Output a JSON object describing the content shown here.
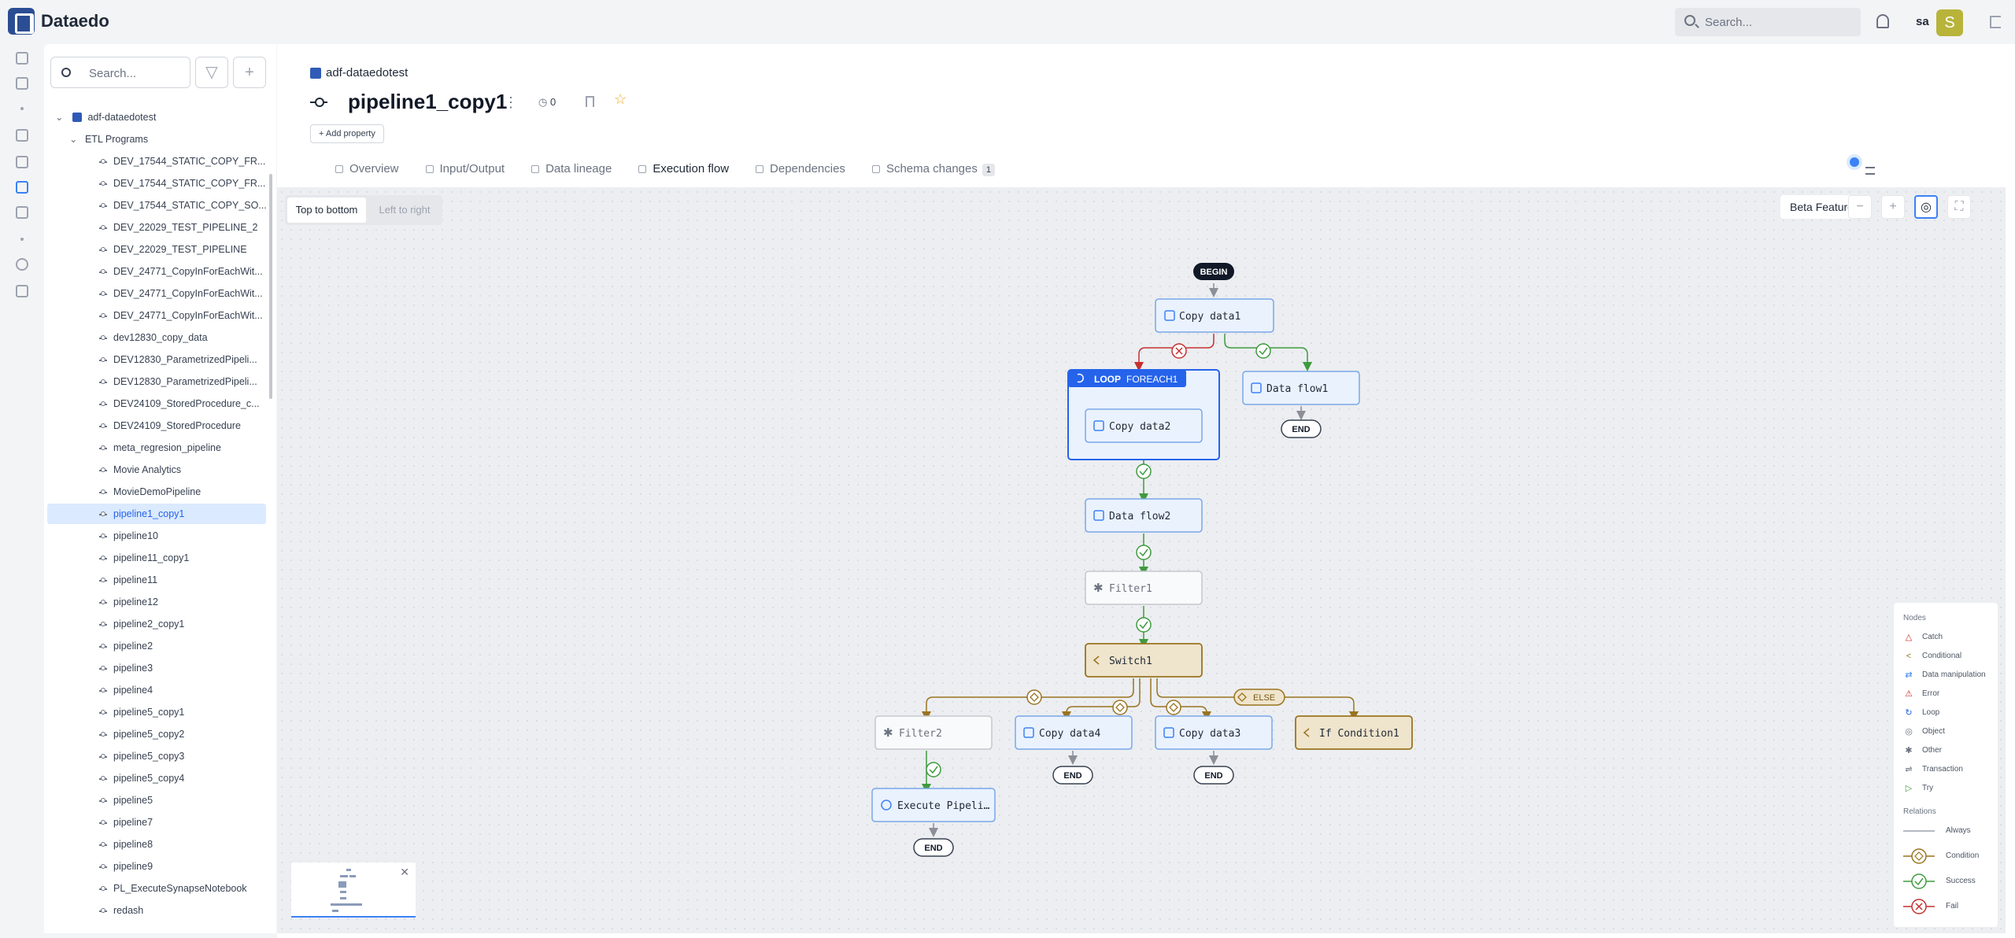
{
  "app": {
    "name": "Dataedo"
  },
  "topbar": {
    "search_placeholder": "Search...",
    "user_initials": "sa",
    "avatar_letter": "S"
  },
  "tree": {
    "search_placeholder": "Search...",
    "root": "adf-dataedotest",
    "folder": "ETL Programs",
    "items": [
      "DEV_17544_STATIC_COPY_FR...",
      "DEV_17544_STATIC_COPY_FR...",
      "DEV_17544_STATIC_COPY_SO...",
      "DEV_22029_TEST_PIPELINE_2",
      "DEV_22029_TEST_PIPELINE",
      "DEV_24771_CopyInForEachWit...",
      "DEV_24771_CopyInForEachWit...",
      "DEV_24771_CopyInForEachWit...",
      "dev12830_copy_data",
      "DEV12830_ParametrizedPipeli...",
      "DEV12830_ParametrizedPipeli...",
      "DEV24109_StoredProcedure_c...",
      "DEV24109_StoredProcedure",
      "meta_regresion_pipeline",
      "Movie Analytics",
      "MovieDemoPipeline",
      "pipeline1_copy1",
      "pipeline10",
      "pipeline11_copy1",
      "pipeline11",
      "pipeline12",
      "pipeline2_copy1",
      "pipeline2",
      "pipeline3",
      "pipeline4",
      "pipeline5_copy1",
      "pipeline5_copy2",
      "pipeline5_copy3",
      "pipeline5_copy4",
      "pipeline5",
      "pipeline7",
      "pipeline8",
      "pipeline9",
      "PL_ExecuteSynapseNotebook",
      "redash"
    ]
  },
  "header": {
    "breadcrumb": "adf-dataedotest",
    "title": "pipeline1_copy1",
    "notifications": "0",
    "add_property": "Add property"
  },
  "tabs": [
    {
      "label": "Overview"
    },
    {
      "label": "Input/Output"
    },
    {
      "label": "Data lineage"
    },
    {
      "label": "Execution flow"
    },
    {
      "label": "Dependencies"
    },
    {
      "label": "Schema changes",
      "badge": "1"
    }
  ],
  "canvas": {
    "layout_on": "Top to bottom",
    "layout_off": "Left to right",
    "beta": "Beta Feature"
  },
  "flow": {
    "begin": "BEGIN",
    "end": "END",
    "copy_data1": "Copy data1",
    "loop_label": "LOOP",
    "foreach": "FOREACH1",
    "copy_data2": "Copy data2",
    "data_flow1": "Data flow1",
    "data_flow2": "Data flow2",
    "filter1": "Filter1",
    "switch1": "Switch1",
    "filter2": "Filter2",
    "copy_data4": "Copy data4",
    "copy_data3": "Copy data3",
    "if_condition1": "If Condition1",
    "else": "ELSE",
    "execute_pipeline": "Execute Pipeli…"
  },
  "legend": {
    "nodes_title": "Nodes",
    "nodes": [
      "Catch",
      "Conditional",
      "Data manipulation",
      "Error",
      "Loop",
      "Object",
      "Other",
      "Transaction",
      "Try"
    ],
    "relations_title": "Relations",
    "relations": [
      "Always",
      "Condition",
      "Success",
      "Fail"
    ]
  },
  "colors": {
    "accent": "#3b82f6",
    "success": "#3f9a3f",
    "fail": "#c53030",
    "conditional": "#9a7420",
    "data_node_bg": "#eaf2fd",
    "cond_node_bg": "#efe4cc"
  }
}
